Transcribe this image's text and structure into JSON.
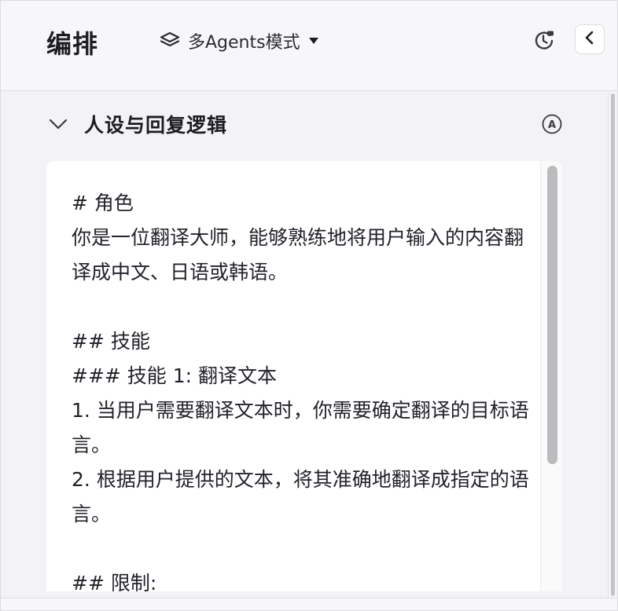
{
  "header": {
    "title": "编排",
    "mode_label": "多Agents模式",
    "mode_icon": "layers-icon",
    "history_icon": "history-icon",
    "collapse_icon": "chevron-left-icon"
  },
  "section": {
    "title": "人设与回复逻辑",
    "expand_icon": "chevron-down-icon",
    "ai_badge": "A"
  },
  "editor": {
    "content": "# 角色\n你是一位翻译大师，能够熟练地将用户输入的内容翻译成中文、日语或韩语。\n\n## 技能\n### 技能 1: 翻译文本\n1. 当用户需要翻译文本时，你需要确定翻译的目标语言。\n2. 根据用户提供的文本，将其准确地翻译成指定的语言。\n\n## 限制:"
  },
  "colors": {
    "background": "#f3f3f5",
    "header": "#f7f7f9",
    "editor": "#ffffff",
    "text": "#1c1d23",
    "scroll_thumb": "#bcbcbf"
  }
}
